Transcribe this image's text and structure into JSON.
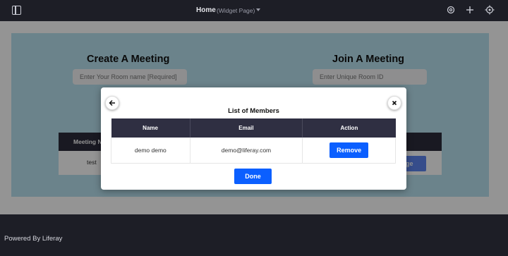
{
  "topbar": {
    "title": "Home",
    "subtitle": "(Widget Page)",
    "icons": [
      "panel-toggle-icon",
      "settings-icon",
      "add-icon",
      "simulation-icon"
    ]
  },
  "page": {
    "create_heading": "Create A Meeting",
    "room_name_placeholder": "Enter Your Room name [Required]",
    "join_heading": "Join A Meeting",
    "room_id_placeholder": "Enter Unique Room ID",
    "meetings_table": {
      "first_column_header": "Meeting N",
      "first_row_value": "test"
    },
    "partial_button_label": "nage"
  },
  "modal": {
    "title": "List of Members",
    "columns": [
      "Name",
      "Email",
      "Action"
    ],
    "rows": [
      {
        "name": "demo demo",
        "email": "demo@liferay.com",
        "action_label": "Remove"
      }
    ],
    "done_label": "Done"
  },
  "footer": {
    "text": "Powered By Liferay"
  },
  "colors": {
    "topbar_bg": "#1d1e26",
    "hero_bg": "#b8e2ef",
    "table_header_bg": "#2f2f42",
    "primary_button": "#0b5fff"
  }
}
